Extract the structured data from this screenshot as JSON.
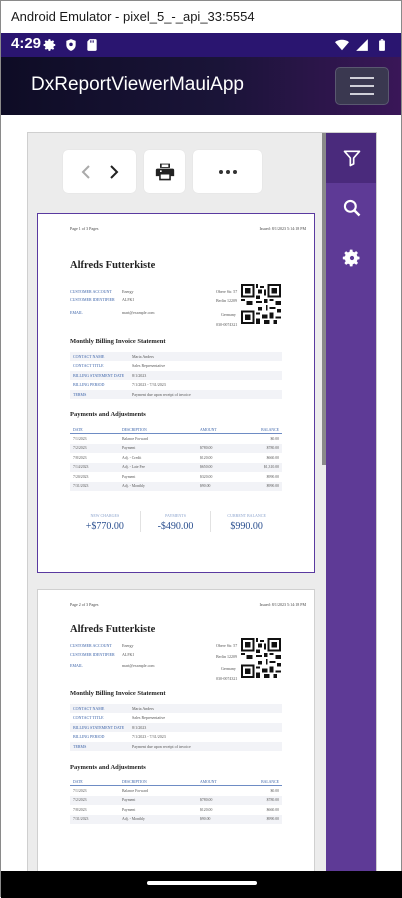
{
  "window": {
    "title": "Android Emulator - pixel_5_-_api_33:5554"
  },
  "status_bar": {
    "time": "4:29",
    "icons": [
      "gear-icon",
      "shield-icon",
      "sd-card-icon",
      "wifi-icon",
      "signal-icon",
      "battery-icon"
    ]
  },
  "app_bar": {
    "title": "DxReportViewerMauiApp",
    "menu_icon": "hamburger-menu-icon"
  },
  "toolbar": {
    "buttons": [
      "chevron-left-icon",
      "chevron-right-icon",
      "print-icon",
      "more-icon"
    ]
  },
  "sidebar": {
    "buttons": [
      "filter-icon",
      "search-icon",
      "gear-icon"
    ]
  },
  "colors": {
    "accent": "#5e3a96",
    "statusbar": "#2a1570",
    "link_blue": "#3a62a8",
    "value_blue": "#2a4f8f"
  },
  "pages": [
    {
      "page_label": "Page 1 of 3 Pages",
      "issued": "Issued: 8/1/2023 5:14:18 PM",
      "customer": "Alfreds Futterkiste",
      "fields": [
        {
          "k": "CUSTOMER ACCOUNT",
          "v": "Energy"
        },
        {
          "k": "CUSTOMER IDENTIFIER",
          "v": "ALFKI"
        },
        {
          "k": "EMAIL",
          "v": "mari@example.com"
        }
      ],
      "right_fields": [
        "Obere Str. 57",
        "Berlin 12209",
        "Germany",
        "030-0074321"
      ],
      "statement_title": "Monthly Billing Invoice Statement",
      "info_rows": [
        {
          "k": "CONTACT NAME",
          "v": "Maria Anders"
        },
        {
          "k": "CONTACT TITLE",
          "v": "Sales Representative"
        },
        {
          "k": "BILLING STATEMENT DATE",
          "v": "8/1/2023"
        },
        {
          "k": "BILLING PERIOD",
          "v": "7/1/2023 - 7/31/2023"
        },
        {
          "k": "TERMS",
          "v": "Payment due upon receipt of invoice"
        }
      ],
      "payments_title": "Payments and Adjustments",
      "payments_header": [
        "DATE",
        "DESCRIPTION",
        "AMOUNT",
        "BALANCE"
      ],
      "payments_rows": [
        [
          "7/1/2023",
          "Balance Forward",
          "",
          "$0.00"
        ],
        [
          "7/2/2023",
          "Payment",
          "$780.00",
          "$780.00"
        ],
        [
          "7/8/2023",
          "Adj. - Credit",
          "$120.00",
          "$660.00"
        ],
        [
          "7/14/2023",
          "Adj. - Late Fee",
          "$650.00",
          "$1,310.00"
        ],
        [
          "7/20/2023",
          "Payment",
          "$320.00",
          "$990.00"
        ],
        [
          "7/31/2023",
          "Adj. - Monthly",
          "$90.00",
          "$990.00"
        ]
      ],
      "summary": [
        {
          "label": "NEW CHARGES",
          "value": "+$770.00"
        },
        {
          "label": "PAYMENTS",
          "value": "-$490.00"
        },
        {
          "label": "CURRENT BALANCE",
          "value": "$990.00"
        }
      ]
    },
    {
      "page_label": "Page 2 of 3 Pages",
      "issued": "Issued: 8/1/2023 5:14:18 PM",
      "customer": "Alfreds Futterkiste",
      "fields": [
        {
          "k": "CUSTOMER ACCOUNT",
          "v": "Energy"
        },
        {
          "k": "CUSTOMER IDENTIFIER",
          "v": "ALFKI"
        },
        {
          "k": "EMAIL",
          "v": "mari@example.com"
        }
      ],
      "right_fields": [
        "Obere Str. 57",
        "Berlin 12209",
        "Germany",
        "030-0074321"
      ],
      "statement_title": "Monthly Billing Invoice Statement",
      "info_rows": [
        {
          "k": "CONTACT NAME",
          "v": "Maria Anders"
        },
        {
          "k": "CONTACT TITLE",
          "v": "Sales Representative"
        },
        {
          "k": "BILLING STATEMENT DATE",
          "v": "8/1/2023"
        },
        {
          "k": "BILLING PERIOD",
          "v": "7/1/2023 - 7/31/2023"
        },
        {
          "k": "TERMS",
          "v": "Payment due upon receipt of invoice"
        }
      ],
      "payments_title": "Payments and Adjustments",
      "payments_header": [
        "DATE",
        "DESCRIPTION",
        "AMOUNT",
        "BALANCE"
      ],
      "payments_rows": [
        [
          "7/1/2023",
          "Balance Forward",
          "",
          "$0.00"
        ],
        [
          "7/2/2023",
          "Payment",
          "$780.00",
          "$780.00"
        ],
        [
          "7/8/2023",
          "Payment",
          "$120.00",
          "$660.00"
        ],
        [
          "7/31/2023",
          "Adj. - Monthly",
          "$90.00",
          "$990.00"
        ]
      ]
    }
  ]
}
